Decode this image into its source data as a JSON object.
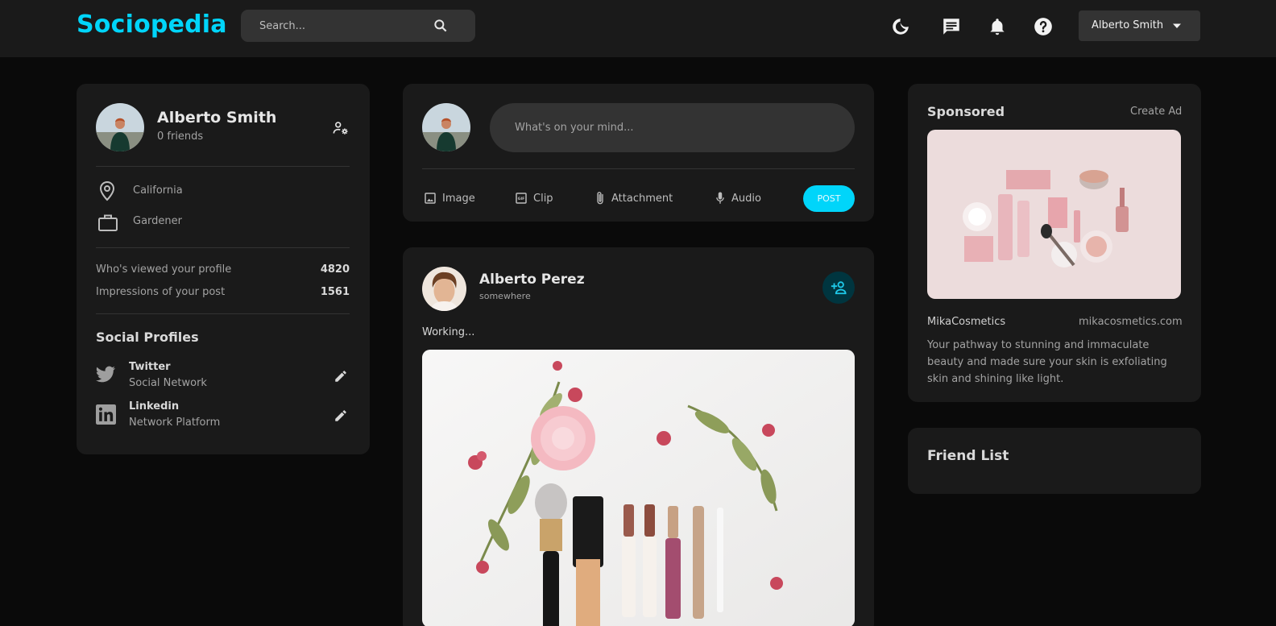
{
  "app": {
    "name": "Sociopedia"
  },
  "search": {
    "placeholder": "Search..."
  },
  "nav": {
    "user_name": "Alberto Smith"
  },
  "profile": {
    "name": "Alberto Smith",
    "friends": "0 friends",
    "location": "California",
    "occupation": "Gardener",
    "viewed_label": "Who's viewed your profile",
    "viewed_value": "4820",
    "impressions_label": "Impressions of your post",
    "impressions_value": "1561",
    "social_title": "Social Profiles",
    "socials": [
      {
        "name": "Twitter",
        "sub": "Social Network"
      },
      {
        "name": "Linkedin",
        "sub": "Network Platform"
      }
    ]
  },
  "composer": {
    "placeholder": "What's on your mind...",
    "actions": [
      "Image",
      "Clip",
      "Attachment",
      "Audio"
    ],
    "post_label": "POST"
  },
  "post": {
    "author": "Alberto Perez",
    "location": "somewhere",
    "text": "Working..."
  },
  "ad": {
    "title": "Sponsored",
    "create": "Create Ad",
    "brand": "MikaCosmetics",
    "site": "mikacosmetics.com",
    "line1": "Your pathway to stunning and immaculate",
    "line2": "beauty and made sure your skin is exfoliating",
    "line3": "skin and shining like light."
  },
  "friends": {
    "title": "Friend List"
  },
  "colors": {
    "accent": "#00d5fa",
    "card": "#1a1a1a",
    "background": "#0a0a0a"
  }
}
